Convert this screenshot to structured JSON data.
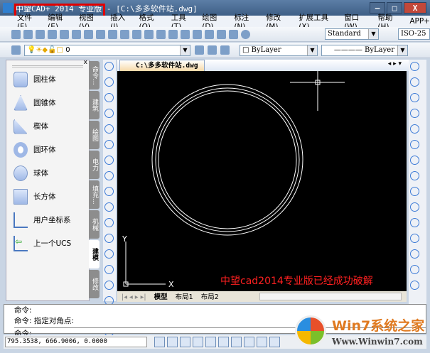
{
  "window": {
    "title": "中望CAD+ 2014 专业版 - [C:\\多多软件站.dwg]",
    "min": "—",
    "max": "□",
    "close": "X",
    "highlight_color": "#e00000"
  },
  "menu": [
    "文件(F)",
    "编辑(E)",
    "视图(V)",
    "插入(I)",
    "格式(O)",
    "工具(T)",
    "绘图(D)",
    "标注(N)",
    "修改(M)",
    "扩展工具(X)",
    "窗口(W)",
    "帮助(H)",
    "APP+"
  ],
  "toolbar": {
    "text_style": "Standard",
    "dim_style": "ISO-25",
    "layer": "0",
    "color": "ByLayer",
    "linetype": "ByLayer"
  },
  "palette": {
    "close": "x",
    "items": [
      "圆柱体",
      "圆锥体",
      "楔体",
      "圆环体",
      "球体",
      "长方体",
      "用户坐标系",
      "上一个UCS"
    ],
    "tabs": [
      "命令...",
      "建筑",
      "绘图",
      "电力",
      "填充...",
      "机械",
      "建模",
      "修改"
    ],
    "active_tab": "建模"
  },
  "document": {
    "tab": "C:\\多多软件站.dwg",
    "overlay_text": "中望cad2014专业版已经成功破解",
    "overlay_color": "#ff2020",
    "ucs_x": "X",
    "ucs_y": "Y"
  },
  "layout_tabs": [
    "模型",
    "布局1",
    "布局2"
  ],
  "command": {
    "lines": [
      "命令:",
      "命令:  指定对角点:"
    ],
    "prompt": "命令:"
  },
  "status": {
    "coords": "795.3538,   666.9006,  0.0000"
  },
  "watermark": {
    "brand": "Win7系统之家",
    "url": "Www.Winwin7.com"
  }
}
